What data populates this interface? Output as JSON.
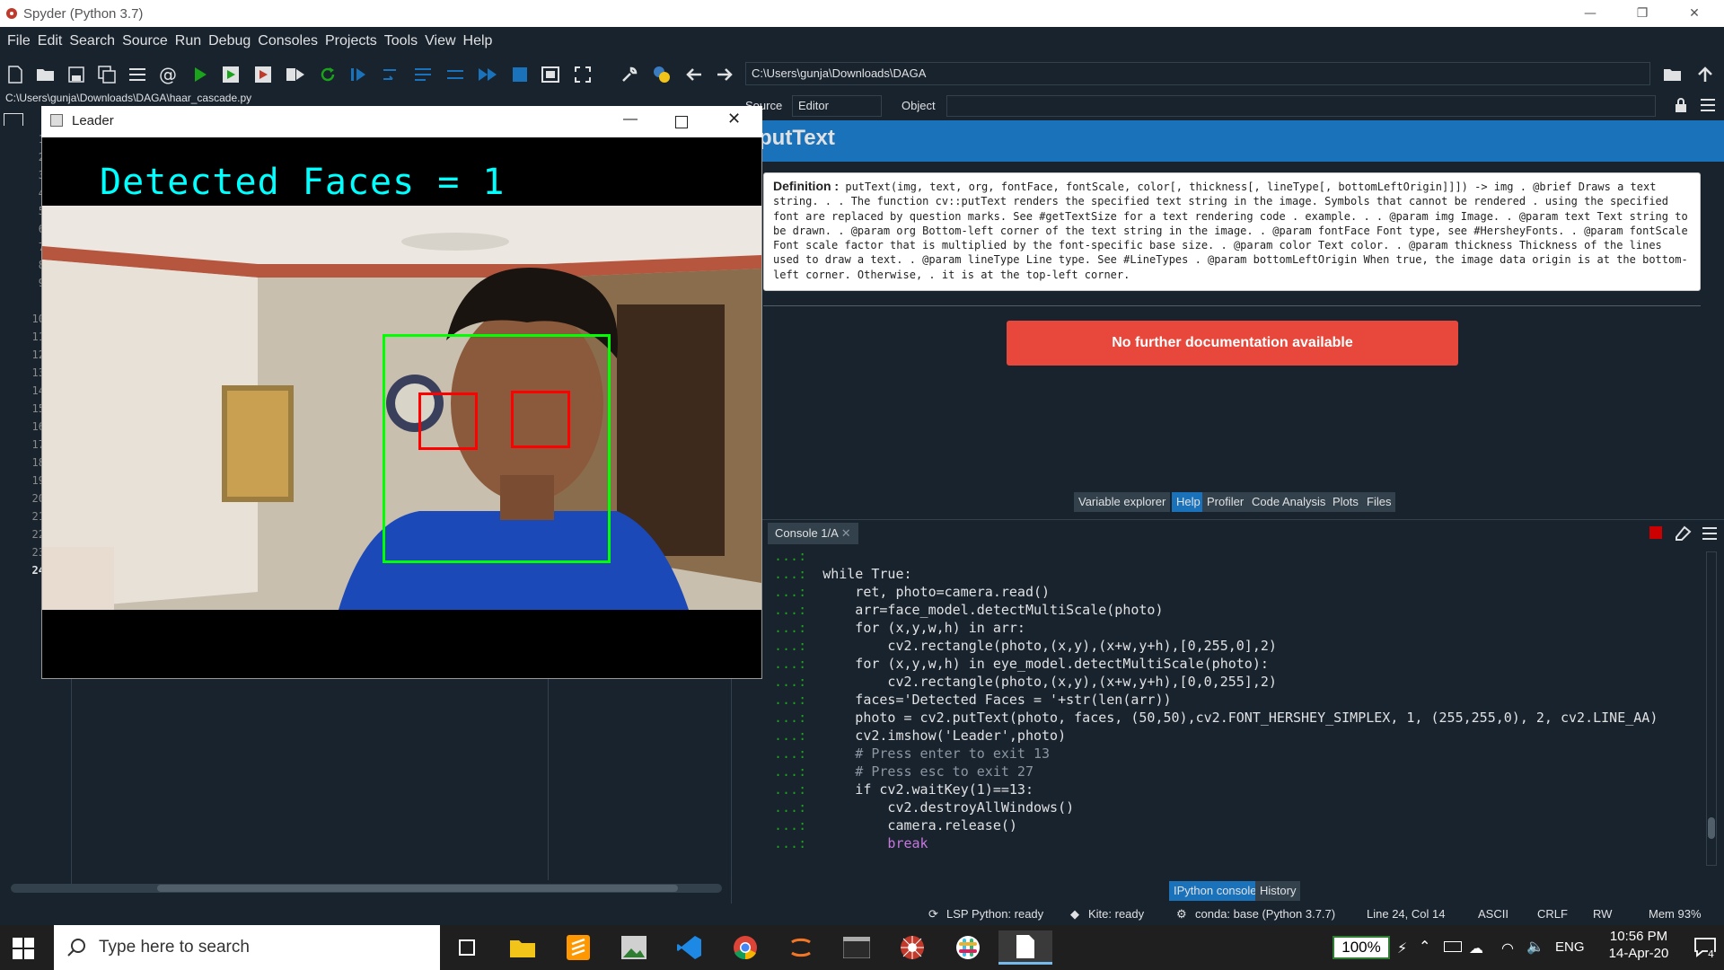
{
  "window": {
    "title": "Spyder (Python 3.7)"
  },
  "menu": [
    "File",
    "Edit",
    "Search",
    "Source",
    "Run",
    "Debug",
    "Consoles",
    "Projects",
    "Tools",
    "View",
    "Help"
  ],
  "toolbar": {
    "path": "C:\\Users\\gunja\\Downloads\\DAGA"
  },
  "editor": {
    "file_path": "C:\\Users\\gunja\\Downloads\\DAGA\\haar_cascade.py",
    "line_numbers": [
      "1",
      "2",
      "3",
      "4",
      "5",
      "6",
      "7",
      "8",
      "9",
      "10",
      "11",
      "12",
      "13",
      "14",
      "15",
      "16",
      "17",
      "18",
      "19",
      "20",
      "21",
      "22",
      "23",
      "24"
    ]
  },
  "leader_window": {
    "title": "Leader",
    "overlay_text": "Detected Faces = 1"
  },
  "help": {
    "source_label": "Source",
    "source_value": "Editor",
    "object_label": "Object",
    "heading": "putText",
    "definition_label": "Definition :",
    "definition_text": "putText(img, text, org, fontFace, fontScale, color[, thickness[, lineType[, bottomLeftOrigin]]]) -> img . @brief Draws a text string. . . The function cv::putText renders the specified text string in the image. Symbols that cannot be rendered . using the specified font are replaced by question marks. See #getTextSize for a text rendering code . example. . . @param img Image. . @param text Text string to be drawn. . @param org Bottom-left corner of the text string in the image. . @param fontFace Font type, see #HersheyFonts. . @param fontScale Font scale factor that is multiplied by the font-specific base size. . @param color Text color. . @param thickness Thickness of the lines used to draw a text. . @param lineType Line type. See #LineTypes . @param bottomLeftOrigin When true, the image data origin is at the bottom-left corner. Otherwise, . it is at the top-left corner.",
    "no_doc": "No further documentation available"
  },
  "pane_tabs": [
    "Variable explorer",
    "Help",
    "Profiler",
    "Code Analysis",
    "Plots",
    "Files"
  ],
  "console": {
    "tab": "Console 1/A",
    "lines": [
      {
        "p": "...:",
        "c": ""
      },
      {
        "p": "...:",
        "c": "while True:"
      },
      {
        "p": "...:",
        "c": "    ret, photo=camera.read()"
      },
      {
        "p": "...:",
        "c": "    arr=face_model.detectMultiScale(photo)"
      },
      {
        "p": "...:",
        "c": "    for (x,y,w,h) in arr:"
      },
      {
        "p": "...:",
        "c": "        cv2.rectangle(photo,(x,y),(x+w,y+h),[0,255,0],2)"
      },
      {
        "p": "...:",
        "c": "    for (x,y,w,h) in eye_model.detectMultiScale(photo):"
      },
      {
        "p": "...:",
        "c": "        cv2.rectangle(photo,(x,y),(x+w,y+h),[0,0,255],2)"
      },
      {
        "p": "...:",
        "c": "    faces='Detected Faces = '+str(len(arr))"
      },
      {
        "p": "...:",
        "c": "    photo = cv2.putText(photo, faces, (50,50),cv2.FONT_HERSHEY_SIMPLEX, 1, (255,255,0), 2, cv2.LINE_AA)"
      },
      {
        "p": "...:",
        "c": "    cv2.imshow('Leader',photo)"
      },
      {
        "p": "...:",
        "c": "    # Press enter to exit 13"
      },
      {
        "p": "...:",
        "c": "    # Press esc to exit 27"
      },
      {
        "p": "...:",
        "c": "    if cv2.waitKey(1)==13:"
      },
      {
        "p": "...:",
        "c": "        cv2.destroyAllWindows()"
      },
      {
        "p": "...:",
        "c": "        camera.release()"
      },
      {
        "p": "...:",
        "c": "        break"
      }
    ],
    "bottom_tabs": [
      "IPython console",
      "History"
    ]
  },
  "status": {
    "lsp": "LSP Python: ready",
    "kite": "Kite: ready",
    "conda": "conda: base (Python 3.7.7)",
    "pos": "Line 24, Col 14",
    "enc": "ASCII",
    "eol": "CRLF",
    "rw": "RW",
    "mem": "Mem 93%"
  },
  "taskbar": {
    "search_placeholder": "Type here to search",
    "battery": "100%",
    "lang": "ENG",
    "time": "10:56 PM",
    "date": "14-Apr-20",
    "notifications": "4"
  },
  "colors": {
    "accent": "#1a72bb",
    "bg": "#19232d",
    "nodoc": "#e7483b",
    "face_box": "#00ff00",
    "eye_box": "#ff0000",
    "overlay_text": "#00ffff"
  }
}
